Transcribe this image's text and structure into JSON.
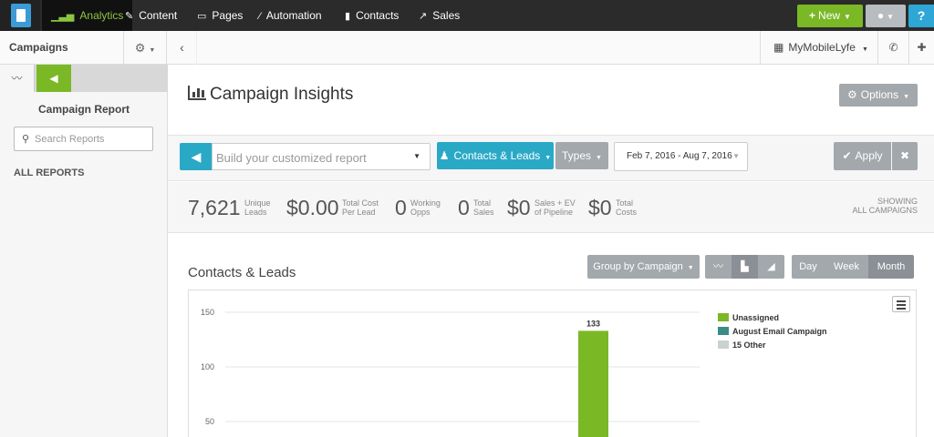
{
  "nav": {
    "items": [
      {
        "label": "Analytics",
        "icon": "chart-icon"
      },
      {
        "label": "Content",
        "icon": "pencil-icon"
      },
      {
        "label": "Pages",
        "icon": "window-icon"
      },
      {
        "label": "Automation",
        "icon": "wand-icon"
      },
      {
        "label": "Contacts",
        "icon": "contact-book-icon"
      },
      {
        "label": "Sales",
        "icon": "trend-icon"
      }
    ],
    "new_label": "New",
    "help_label": "?"
  },
  "subbar": {
    "title": "Campaigns",
    "account": "MyMobileLyfe"
  },
  "sidebar": {
    "heading": "Campaign Report",
    "search_placeholder": "Search Reports",
    "all_reports": "ALL REPORTS"
  },
  "main": {
    "title": "Campaign Insights",
    "options_label": "Options"
  },
  "filters": {
    "report_placeholder": "Build your customized report",
    "contacts_label": "Contacts & Leads",
    "types_label": "Types",
    "date_range": "Feb 7, 2016 - Aug 7, 2016",
    "apply_label": "Apply"
  },
  "stats": [
    {
      "value": "7,621",
      "label1": "Unique",
      "label2": "Leads"
    },
    {
      "value": "$0.00",
      "label1": "Total Cost",
      "label2": "Per Lead"
    },
    {
      "value": "0",
      "label1": "Working",
      "label2": "Opps"
    },
    {
      "value": "0",
      "label1": "Total",
      "label2": "Sales"
    },
    {
      "value": "$0",
      "label1": "Sales + EV",
      "label2": "of Pipeline"
    },
    {
      "value": "$0",
      "label1": "Total",
      "label2": "Costs"
    }
  ],
  "showing": {
    "line1": "SHOWING",
    "line2": "ALL CAMPAIGNS"
  },
  "section": {
    "title": "Contacts & Leads",
    "group_label": "Group by Campaign",
    "periods": [
      "Day",
      "Week",
      "Month"
    ]
  },
  "colors": {
    "accent_green": "#7ab826",
    "accent_blue": "#2aa9c6",
    "gray_button": "#a2a8ac"
  },
  "chart_data": {
    "type": "bar",
    "series": [
      {
        "name": "Unassigned",
        "color": "#7ab826",
        "values": [
          133
        ]
      },
      {
        "name": "August Email Campaign",
        "color": "#3a8c86",
        "values": []
      },
      {
        "name": "15 Other",
        "color": "#c9d1d1",
        "values": []
      }
    ],
    "data_labels": [
      "133"
    ],
    "y_ticks": [
      "150",
      "100",
      "50"
    ],
    "ylim": [
      0,
      150
    ],
    "grid": true,
    "legend_position": "right"
  }
}
